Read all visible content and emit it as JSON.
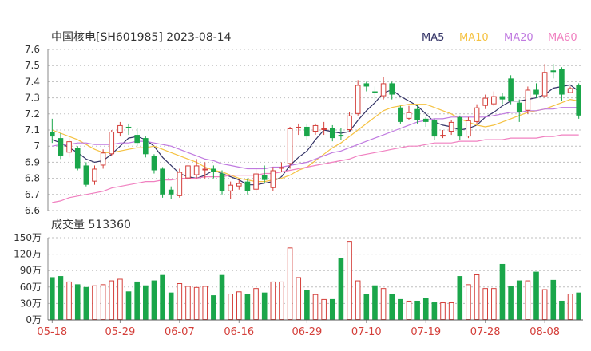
{
  "chart_data": [
    {
      "type": "candlestick",
      "title": "中国核电[SH601985] 2023-08-14",
      "ylim": [
        6.6,
        7.6
      ],
      "yticks": [
        "7.6",
        "7.5",
        "7.4",
        "7.3",
        "7.2",
        "7.1",
        "7",
        "6.9",
        "6.8",
        "6.7",
        "6.6"
      ],
      "grid": true,
      "legend_position": "top-right",
      "legend": [
        {
          "name": "MA5",
          "color": "#333366"
        },
        {
          "name": "MA10",
          "color": "#f5c242"
        },
        {
          "name": "MA20",
          "color": "#c07ae0"
        },
        {
          "name": "MA60",
          "color": "#f080c0"
        }
      ],
      "up_color": "#d43f3a",
      "down_color": "#1aa64a",
      "candles": [
        [
          7.09,
          7.06,
          7.17,
          7.02
        ],
        [
          7.05,
          6.94,
          7.08,
          6.92
        ],
        [
          6.96,
          7.03,
          7.05,
          6.93
        ],
        [
          6.99,
          6.86,
          7.0,
          6.85
        ],
        [
          6.88,
          6.76,
          6.9,
          6.75
        ],
        [
          6.78,
          6.86,
          6.88,
          6.76
        ],
        [
          6.88,
          6.96,
          6.98,
          6.86
        ],
        [
          6.95,
          7.09,
          7.1,
          6.94
        ],
        [
          7.08,
          7.13,
          7.15,
          7.06
        ],
        [
          7.12,
          7.11,
          7.14,
          7.07
        ],
        [
          7.07,
          7.02,
          7.11,
          7.0
        ],
        [
          7.05,
          6.95,
          7.06,
          6.93
        ],
        [
          6.94,
          6.85,
          6.95,
          6.83
        ],
        [
          6.86,
          6.7,
          6.87,
          6.68
        ],
        [
          6.73,
          6.7,
          6.75,
          6.67
        ],
        [
          6.69,
          6.84,
          6.86,
          6.68
        ],
        [
          6.8,
          6.88,
          6.9,
          6.78
        ],
        [
          6.82,
          6.88,
          6.92,
          6.8
        ],
        [
          6.85,
          6.86,
          6.9,
          6.8
        ],
        [
          6.86,
          6.84,
          6.88,
          6.8
        ],
        [
          6.83,
          6.72,
          6.85,
          6.7
        ],
        [
          6.72,
          6.76,
          6.78,
          6.67
        ],
        [
          6.75,
          6.77,
          6.79,
          6.73
        ],
        [
          6.78,
          6.72,
          6.8,
          6.7
        ],
        [
          6.73,
          6.83,
          6.86,
          6.71
        ],
        [
          6.82,
          6.79,
          6.88,
          6.77
        ],
        [
          6.74,
          6.85,
          6.87,
          6.72
        ],
        [
          6.86,
          6.87,
          6.9,
          6.84
        ],
        [
          6.89,
          7.11,
          7.12,
          6.86
        ],
        [
          7.11,
          7.12,
          7.14,
          7.07
        ],
        [
          7.12,
          7.06,
          7.14,
          7.04
        ],
        [
          7.09,
          7.13,
          7.14,
          7.07
        ],
        [
          7.11,
          7.11,
          7.15,
          7.07
        ],
        [
          7.11,
          7.05,
          7.13,
          7.03
        ],
        [
          7.07,
          7.06,
          7.11,
          7.04
        ],
        [
          7.1,
          7.19,
          7.21,
          7.09
        ],
        [
          7.2,
          7.38,
          7.41,
          7.19
        ],
        [
          7.39,
          7.37,
          7.4,
          7.34
        ],
        [
          7.34,
          7.33,
          7.37,
          7.28
        ],
        [
          7.31,
          7.39,
          7.43,
          7.29
        ],
        [
          7.39,
          7.32,
          7.4,
          7.29
        ],
        [
          7.24,
          7.15,
          7.25,
          7.14
        ],
        [
          7.17,
          7.21,
          7.25,
          7.16
        ],
        [
          7.23,
          7.16,
          7.25,
          7.14
        ],
        [
          7.17,
          7.15,
          7.18,
          7.12
        ],
        [
          7.16,
          7.06,
          7.17,
          7.04
        ],
        [
          7.06,
          7.07,
          7.1,
          7.05
        ],
        [
          7.09,
          7.15,
          7.16,
          7.07
        ],
        [
          7.18,
          7.06,
          7.19,
          7.04
        ],
        [
          7.06,
          7.16,
          7.18,
          7.05
        ],
        [
          7.15,
          7.24,
          7.26,
          7.14
        ],
        [
          7.25,
          7.3,
          7.32,
          7.23
        ],
        [
          7.26,
          7.31,
          7.34,
          7.25
        ],
        [
          7.31,
          7.29,
          7.33,
          7.26
        ],
        [
          7.42,
          7.28,
          7.44,
          7.26
        ],
        [
          7.27,
          7.21,
          7.29,
          7.15
        ],
        [
          7.22,
          7.35,
          7.37,
          7.2
        ],
        [
          7.35,
          7.32,
          7.39,
          7.3
        ],
        [
          7.31,
          7.46,
          7.51,
          7.3
        ],
        [
          7.47,
          7.46,
          7.51,
          7.42
        ],
        [
          7.48,
          7.32,
          7.49,
          7.28
        ],
        [
          7.33,
          7.36,
          7.37,
          7.33
        ],
        [
          7.38,
          7.19,
          7.39,
          7.17
        ]
      ],
      "ma": {
        "MA5": [
          7.04,
          7.02,
          6.99,
          6.96,
          6.92,
          6.9,
          6.91,
          6.95,
          7.0,
          7.05,
          7.06,
          7.04,
          7.0,
          6.93,
          6.88,
          6.83,
          6.81,
          6.8,
          6.82,
          6.85,
          6.83,
          6.81,
          6.79,
          6.76,
          6.76,
          6.77,
          6.78,
          6.81,
          6.88,
          6.93,
          6.97,
          7.04,
          7.1,
          7.09,
          7.08,
          7.09,
          7.16,
          7.22,
          7.27,
          7.33,
          7.35,
          7.31,
          7.28,
          7.25,
          7.2,
          7.15,
          7.13,
          7.12,
          7.1,
          7.11,
          7.13,
          7.18,
          7.21,
          7.25,
          7.28,
          7.28,
          7.29,
          7.3,
          7.32,
          7.36,
          7.37,
          7.38,
          7.34
        ],
        "MA10": [
          7.1,
          7.08,
          7.06,
          7.04,
          7.01,
          6.98,
          6.96,
          6.96,
          6.97,
          6.98,
          6.99,
          6.99,
          7.0,
          6.98,
          6.96,
          6.94,
          6.92,
          6.9,
          6.87,
          6.85,
          6.84,
          6.82,
          6.8,
          6.79,
          6.78,
          6.78,
          6.79,
          6.8,
          6.82,
          6.85,
          6.87,
          6.91,
          6.95,
          6.99,
          7.02,
          7.06,
          7.1,
          7.14,
          7.18,
          7.22,
          7.24,
          7.25,
          7.26,
          7.26,
          7.26,
          7.24,
          7.22,
          7.2,
          7.17,
          7.15,
          7.13,
          7.12,
          7.13,
          7.15,
          7.17,
          7.19,
          7.21,
          7.22,
          7.23,
          7.25,
          7.27,
          7.29,
          7.28
        ],
        "MA20": [
          7.0,
          7.01,
          7.01,
          7.02,
          7.02,
          7.01,
          7.01,
          7.01,
          7.02,
          7.02,
          7.03,
          7.03,
          7.02,
          7.01,
          7.0,
          6.98,
          6.96,
          6.94,
          6.92,
          6.91,
          6.89,
          6.88,
          6.87,
          6.86,
          6.86,
          6.86,
          6.87,
          6.87,
          6.88,
          6.89,
          6.9,
          6.92,
          6.94,
          6.96,
          6.97,
          6.99,
          7.01,
          7.03,
          7.05,
          7.07,
          7.09,
          7.11,
          7.13,
          7.15,
          7.16,
          7.17,
          7.17,
          7.18,
          7.18,
          7.18,
          7.18,
          7.18,
          7.19,
          7.2,
          7.21,
          7.21,
          7.22,
          7.22,
          7.23,
          7.23,
          7.24,
          7.24,
          7.24
        ],
        "MA60": [
          6.65,
          6.66,
          6.68,
          6.69,
          6.7,
          6.71,
          6.72,
          6.74,
          6.75,
          6.76,
          6.77,
          6.78,
          6.78,
          6.79,
          6.79,
          6.8,
          6.8,
          6.8,
          6.81,
          6.81,
          6.81,
          6.82,
          6.82,
          6.82,
          6.82,
          6.83,
          6.83,
          6.84,
          6.85,
          6.86,
          6.87,
          6.88,
          6.89,
          6.9,
          6.91,
          6.92,
          6.94,
          6.95,
          6.96,
          6.97,
          6.98,
          6.99,
          7.0,
          7.0,
          7.01,
          7.02,
          7.02,
          7.02,
          7.03,
          7.03,
          7.03,
          7.04,
          7.04,
          7.04,
          7.05,
          7.05,
          7.05,
          7.05,
          7.06,
          7.06,
          7.07,
          7.07,
          7.07
        ]
      }
    },
    {
      "type": "bar",
      "title": "成交量 513360",
      "ylim": [
        0,
        150
      ],
      "yticks": [
        "150万",
        "120万",
        "90万",
        "60万",
        "30万",
        "0万"
      ],
      "grid": true,
      "values": [
        78,
        80,
        70,
        65,
        60,
        63,
        65,
        72,
        75,
        52,
        70,
        63,
        72,
        82,
        50,
        67,
        62,
        60,
        62,
        45,
        82,
        48,
        52,
        48,
        58,
        50,
        70,
        70,
        132,
        78,
        55,
        47,
        38,
        38,
        113,
        144,
        72,
        47,
        63,
        58,
        47,
        38,
        35,
        35,
        40,
        32,
        32,
        32,
        80,
        65,
        83,
        58,
        58,
        102,
        62,
        72,
        72,
        88,
        56,
        73,
        35,
        48,
        50
      ],
      "categories": [
        "05-18",
        "05-29",
        "06-07",
        "06-16",
        "06-29",
        "07-10",
        "07-19",
        "07-28",
        "08-08"
      ]
    }
  ]
}
